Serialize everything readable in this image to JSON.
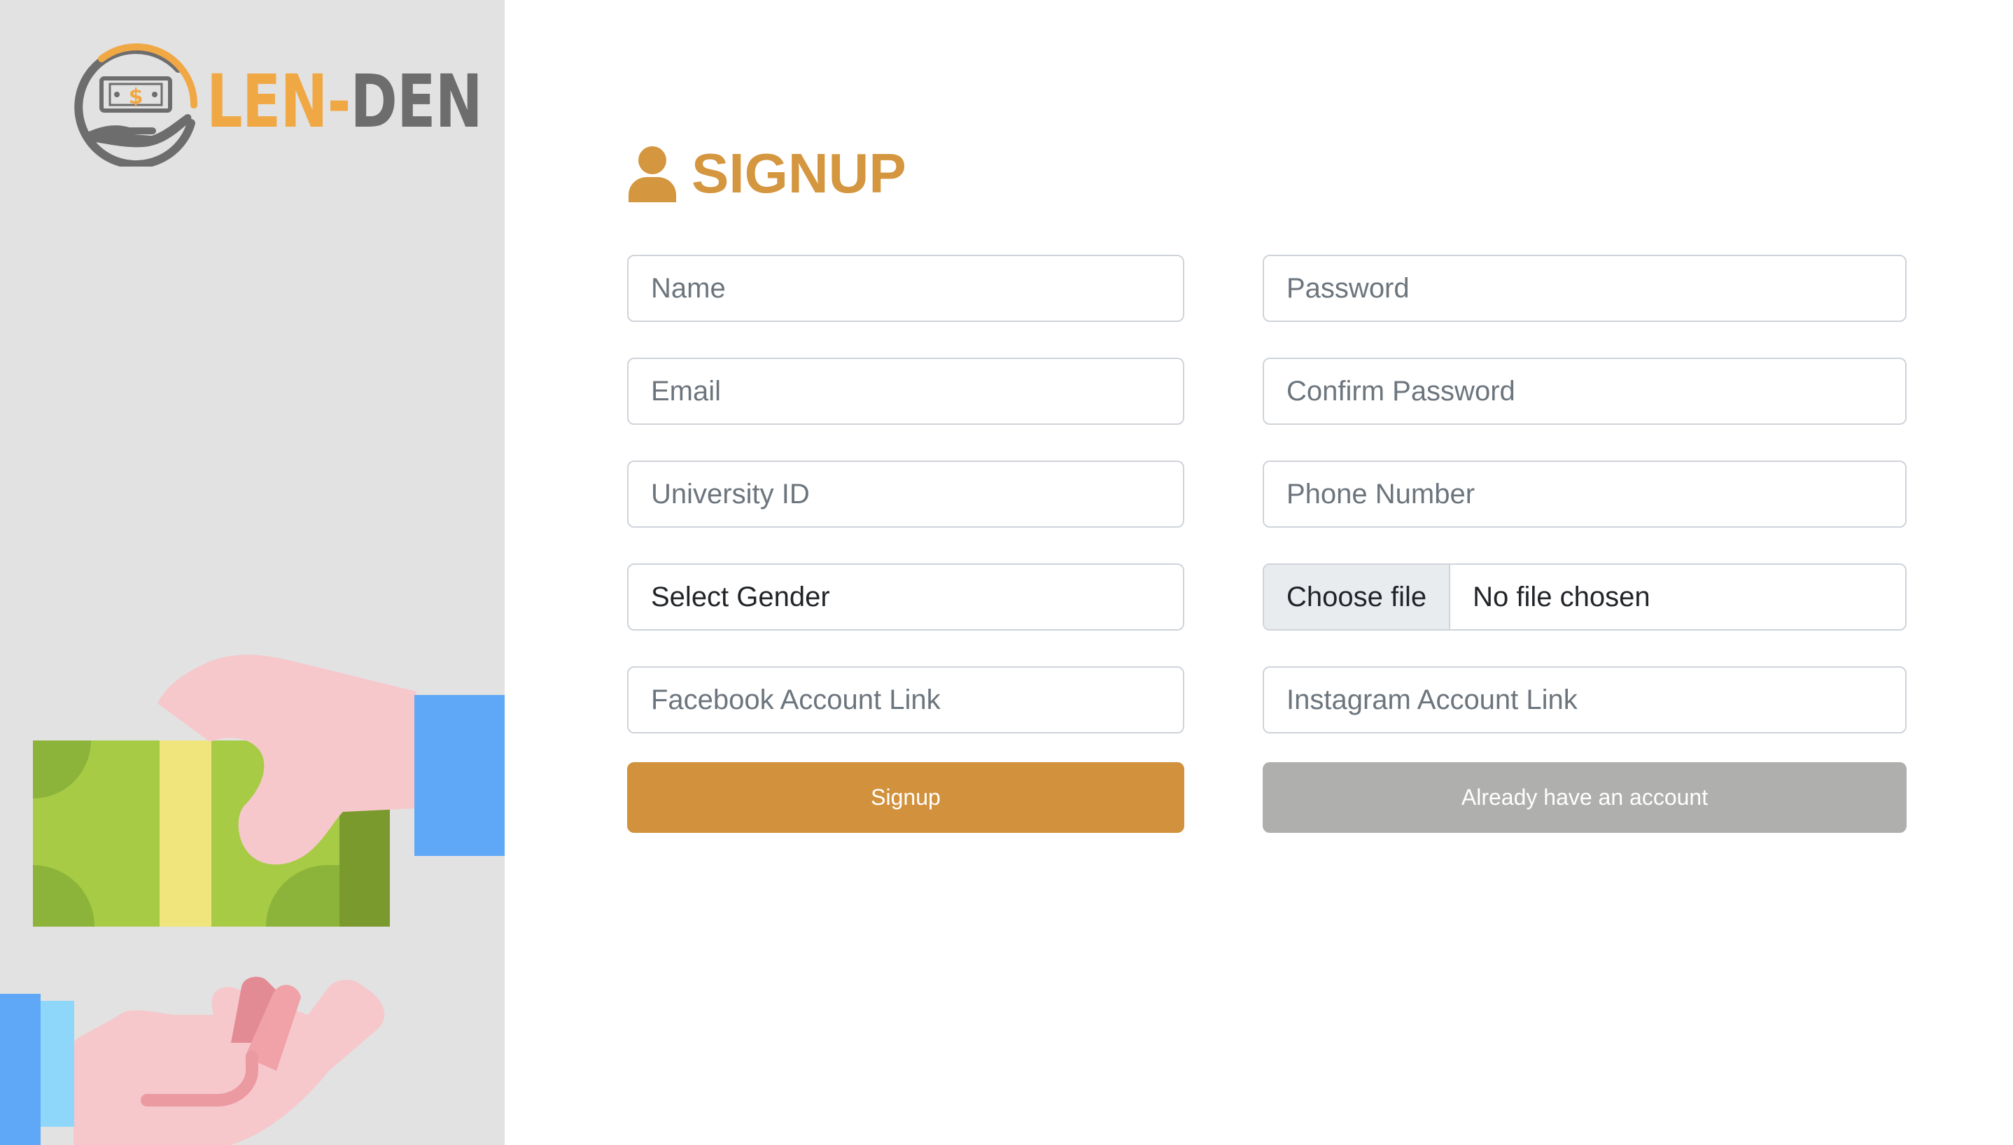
{
  "brand": {
    "name_part1": "LEN-",
    "name_part2": "DEN",
    "color_primary": "#f0a844",
    "color_secondary": "#6d6d6d",
    "emblem_icon": "money-hand-icon",
    "emblem_symbol": "$"
  },
  "illustration": {
    "icon": "money-handover-illustration"
  },
  "form": {
    "heading": "SIGNUP",
    "heading_icon": "user-icon",
    "heading_color": "#d4963f",
    "fields": {
      "name": {
        "placeholder": "Name"
      },
      "email": {
        "placeholder": "Email"
      },
      "university_id": {
        "placeholder": "University ID"
      },
      "gender": {
        "selected": "Select Gender"
      },
      "facebook": {
        "placeholder": "Facebook Account Link"
      },
      "password": {
        "placeholder": "Password"
      },
      "confirm_password": {
        "placeholder": "Confirm Password"
      },
      "phone": {
        "placeholder": "Phone Number"
      },
      "photo": {
        "button_label": "Choose file",
        "status": "No file chosen"
      },
      "instagram": {
        "placeholder": "Instagram Account Link"
      }
    },
    "buttons": {
      "signup": "Signup",
      "login": "Already have an account"
    },
    "colors": {
      "signup_button": "#d2913c",
      "login_button": "#afafad"
    }
  }
}
